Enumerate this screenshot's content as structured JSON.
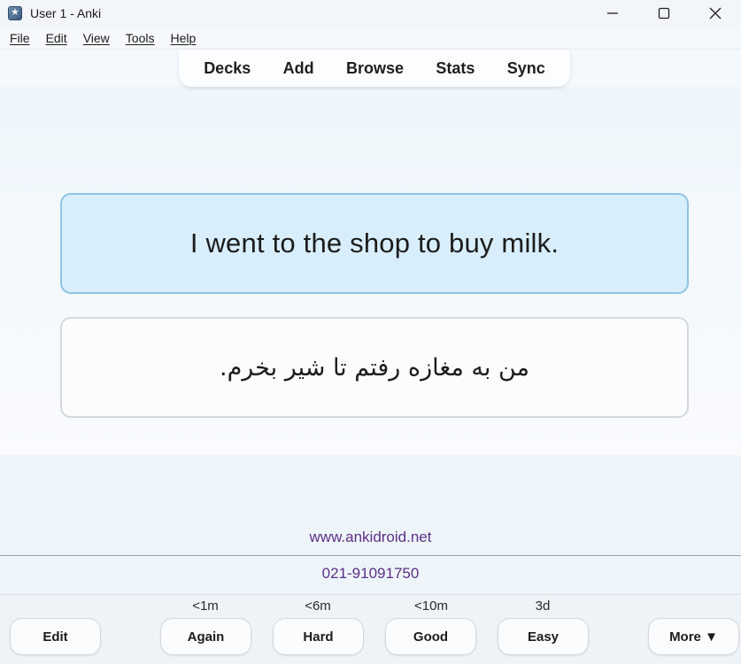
{
  "window": {
    "title": "User 1 - Anki",
    "minimize_icon": "minimize-icon",
    "maximize_icon": "maximize-icon",
    "close_icon": "close-icon"
  },
  "menu": [
    "File",
    "Edit",
    "View",
    "Tools",
    "Help"
  ],
  "toolbar": [
    "Decks",
    "Add",
    "Browse",
    "Stats",
    "Sync"
  ],
  "card": {
    "front": "I went to the shop to buy milk.",
    "back": "من به مغازه رفتم تا شیر بخرم."
  },
  "footer": {
    "website": "www.ankidroid.net",
    "phone": "021-91091750"
  },
  "answer_bar": {
    "edit_label": "Edit",
    "buttons": [
      {
        "label": "Again",
        "due": "<1m"
      },
      {
        "label": "Hard",
        "due": "<6m"
      },
      {
        "label": "Good",
        "due": "<10m"
      },
      {
        "label": "Easy",
        "due": "3d"
      }
    ],
    "more_label": "More ▼"
  },
  "colors": {
    "front_bg": "#d9eefc",
    "front_border": "#8fc4e2",
    "link_color": "#5c2f86"
  }
}
